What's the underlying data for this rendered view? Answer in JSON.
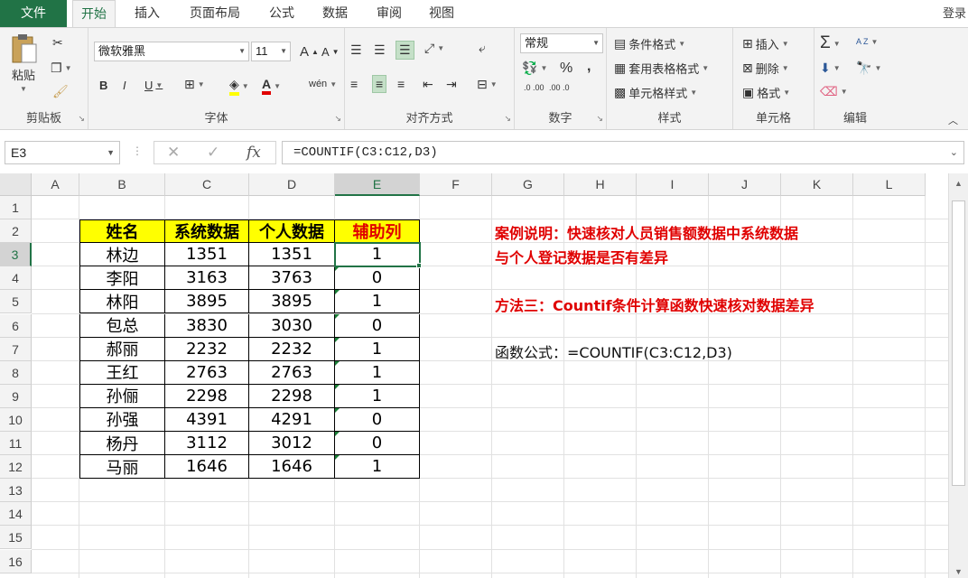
{
  "tabs": {
    "file": "文件",
    "items": [
      "开始",
      "插入",
      "页面布局",
      "公式",
      "数据",
      "审阅",
      "视图"
    ],
    "login": "登录"
  },
  "ribbon": {
    "clipboard": {
      "label": "剪贴板",
      "paste": "粘贴"
    },
    "font": {
      "label": "字体",
      "name": "微软雅黑",
      "size": "11",
      "bold": "B",
      "italic": "I",
      "underline": "U",
      "grow": "A",
      "shrink": "A",
      "phonetic": "wén"
    },
    "alignment": {
      "label": "对齐方式"
    },
    "number": {
      "label": "数字",
      "format": "常规",
      "percent": "%",
      "comma": ",",
      "inc_decimal": ".0 .00",
      "dec_decimal": ".00 .0"
    },
    "styles": {
      "label": "样式",
      "conditional": "条件格式",
      "table": "套用表格格式",
      "cell": "单元格样式"
    },
    "cells": {
      "label": "单元格",
      "insert": "插入",
      "delete": "删除",
      "format": "格式"
    },
    "editing": {
      "label": "编辑",
      "sum": "Σ",
      "sort": "A Z",
      "find": "查找"
    }
  },
  "formula_bar": {
    "name_box": "E3",
    "cancel": "✕",
    "enter": "✓",
    "fx": "fx",
    "formula": "=COUNTIF(C3:C12,D3)"
  },
  "columns": [
    "A",
    "B",
    "C",
    "D",
    "E",
    "F",
    "G",
    "H",
    "I",
    "J",
    "K",
    "L"
  ],
  "rows": [
    "1",
    "2",
    "3",
    "4",
    "5",
    "6",
    "7",
    "8",
    "9",
    "10",
    "11",
    "12",
    "13",
    "14",
    "15",
    "16"
  ],
  "table": {
    "headers": [
      "姓名",
      "系统数据",
      "个人数据",
      "辅助列"
    ],
    "rows": [
      [
        "林边",
        "1351",
        "1351",
        "1"
      ],
      [
        "李阳",
        "3163",
        "3763",
        "0"
      ],
      [
        "林阳",
        "3895",
        "3895",
        "1"
      ],
      [
        "包总",
        "3830",
        "3030",
        "0"
      ],
      [
        "郝丽",
        "2232",
        "2232",
        "1"
      ],
      [
        "王红",
        "2763",
        "2763",
        "1"
      ],
      [
        "孙俪",
        "2298",
        "2298",
        "1"
      ],
      [
        "孙强",
        "4391",
        "4291",
        "0"
      ],
      [
        "杨丹",
        "3112",
        "3012",
        "0"
      ],
      [
        "马丽",
        "1646",
        "1646",
        "1"
      ]
    ]
  },
  "notes": {
    "case_line1": "案例说明：快速核对人员销售额数据中系统数据",
    "case_line2": "与个人登记数据是否有差异",
    "method": "方法三：Countif条件计算函数快速核对数据差异",
    "formula_note": "函数公式：=COUNTIF(C3:C12,D3)"
  },
  "colors": {
    "excel_green": "#217346",
    "header_yellow": "#ffff00",
    "note_red": "#e00000"
  }
}
